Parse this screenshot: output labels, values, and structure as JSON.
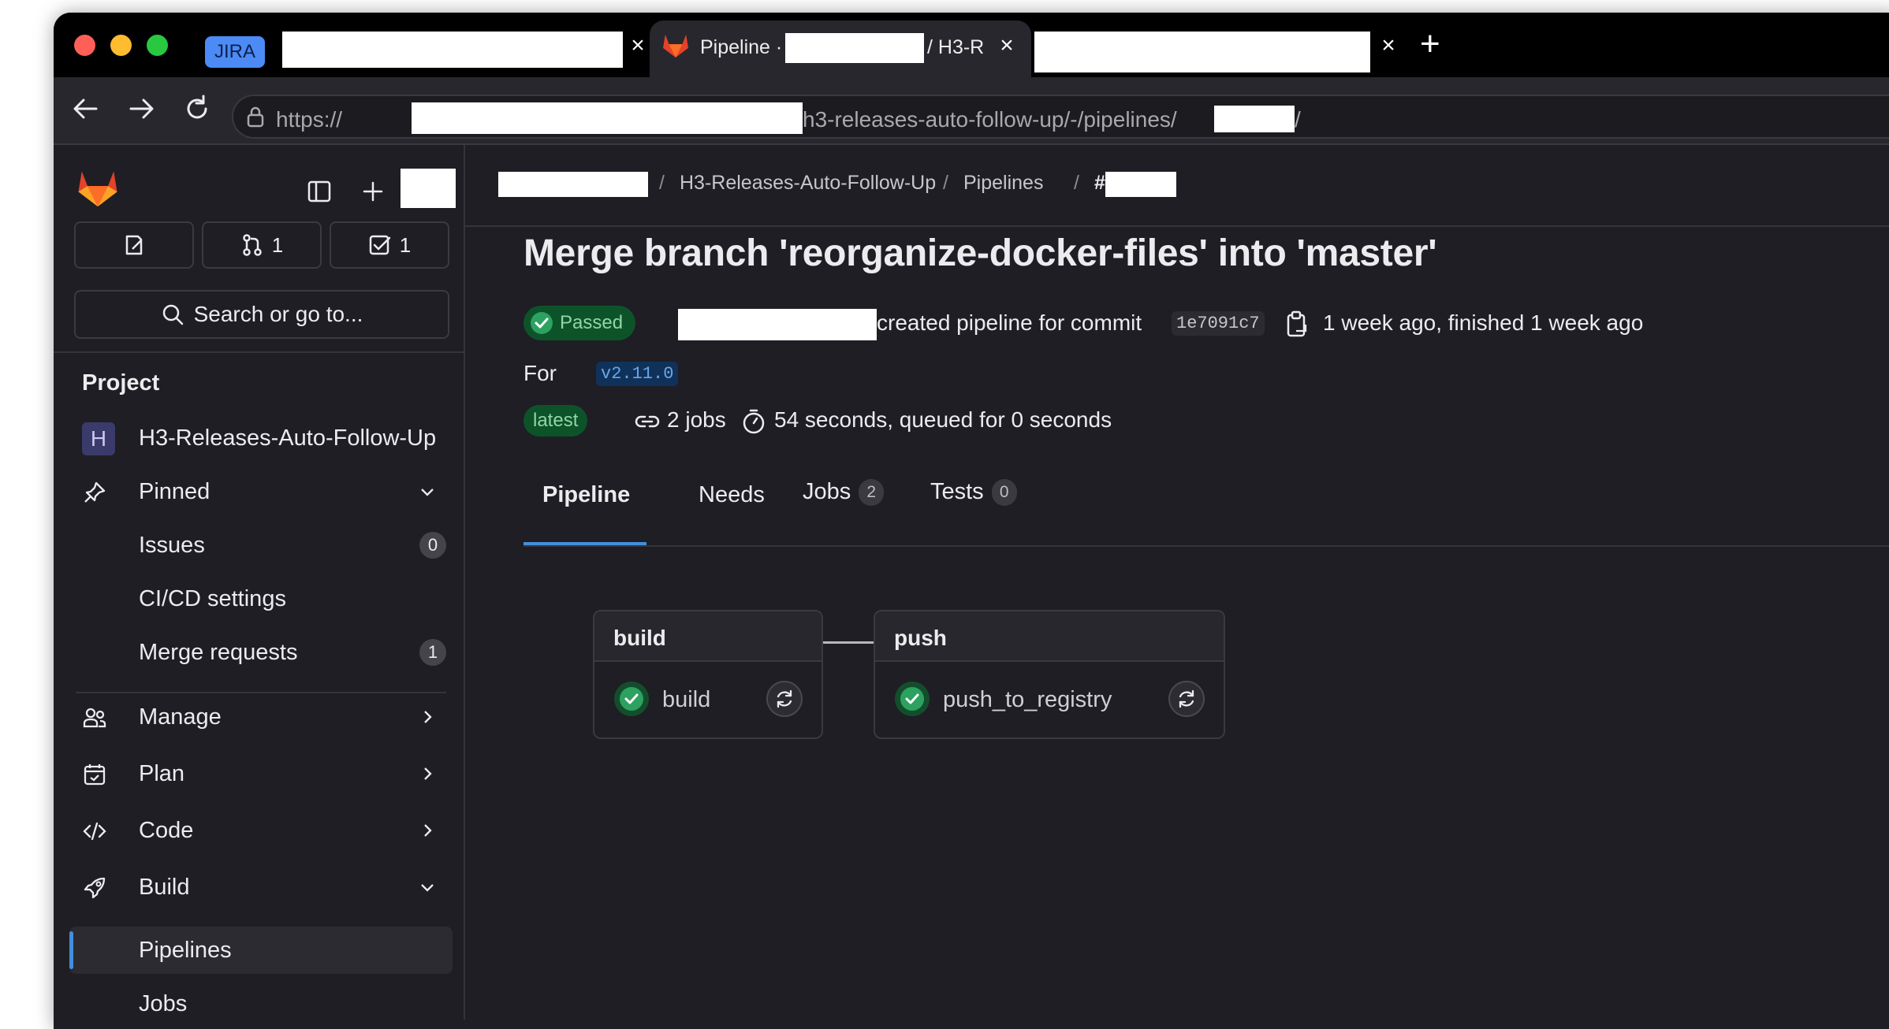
{
  "browser": {
    "tabs": [
      {
        "badge": "JIRA"
      },
      {
        "title": "Pipeline · ",
        "title_tail": "/ H3-R"
      },
      {
        "title": ""
      }
    ],
    "url_prefix": "https://",
    "url_middle": "h3-releases-auto-follow-up/-/pipelines/",
    "url_suffix": "/"
  },
  "sidebar": {
    "counts": {
      "merge_requests": "1",
      "todos": "1"
    },
    "search_placeholder": "Search or go to...",
    "section_title": "Project",
    "project": {
      "avatar_letter": "H",
      "name": "H3-Releases-Auto-Follow-Up"
    },
    "items": {
      "pinned": "Pinned",
      "issues": "Issues",
      "issues_count": "0",
      "cicd": "CI/CD settings",
      "mrs": "Merge requests",
      "mrs_count": "1",
      "manage": "Manage",
      "plan": "Plan",
      "code": "Code",
      "build": "Build",
      "pipelines": "Pipelines",
      "jobs": "Jobs"
    }
  },
  "breadcrumb": {
    "project": "H3-Releases-Auto-Follow-Up",
    "section": "Pipelines",
    "current_prefix": "#",
    "separator": "/"
  },
  "pipeline": {
    "title": "Merge branch 'reorganize-docker-files' into 'master'",
    "status": "Passed",
    "created_text": "created pipeline for commit",
    "commit_sha": "1e7091c7",
    "time_text": "1 week ago, finished 1 week ago",
    "for_label": "For",
    "ref": "v2.11.0",
    "latest_badge": "latest",
    "jobs_text": "2 jobs",
    "duration_text": "54 seconds, queued for 0 seconds"
  },
  "tabs": {
    "pipeline": "Pipeline",
    "needs": "Needs",
    "jobs": "Jobs",
    "jobs_count": "2",
    "tests": "Tests",
    "tests_count": "0"
  },
  "graph": {
    "stages": [
      {
        "name": "build",
        "job": "build"
      },
      {
        "name": "push",
        "job": "push_to_registry"
      }
    ]
  },
  "colors": {
    "accent": "#1f75cb",
    "success": "#2da160",
    "success_bg": "#0d532a",
    "gitlab_orange": "#fc6d26"
  }
}
